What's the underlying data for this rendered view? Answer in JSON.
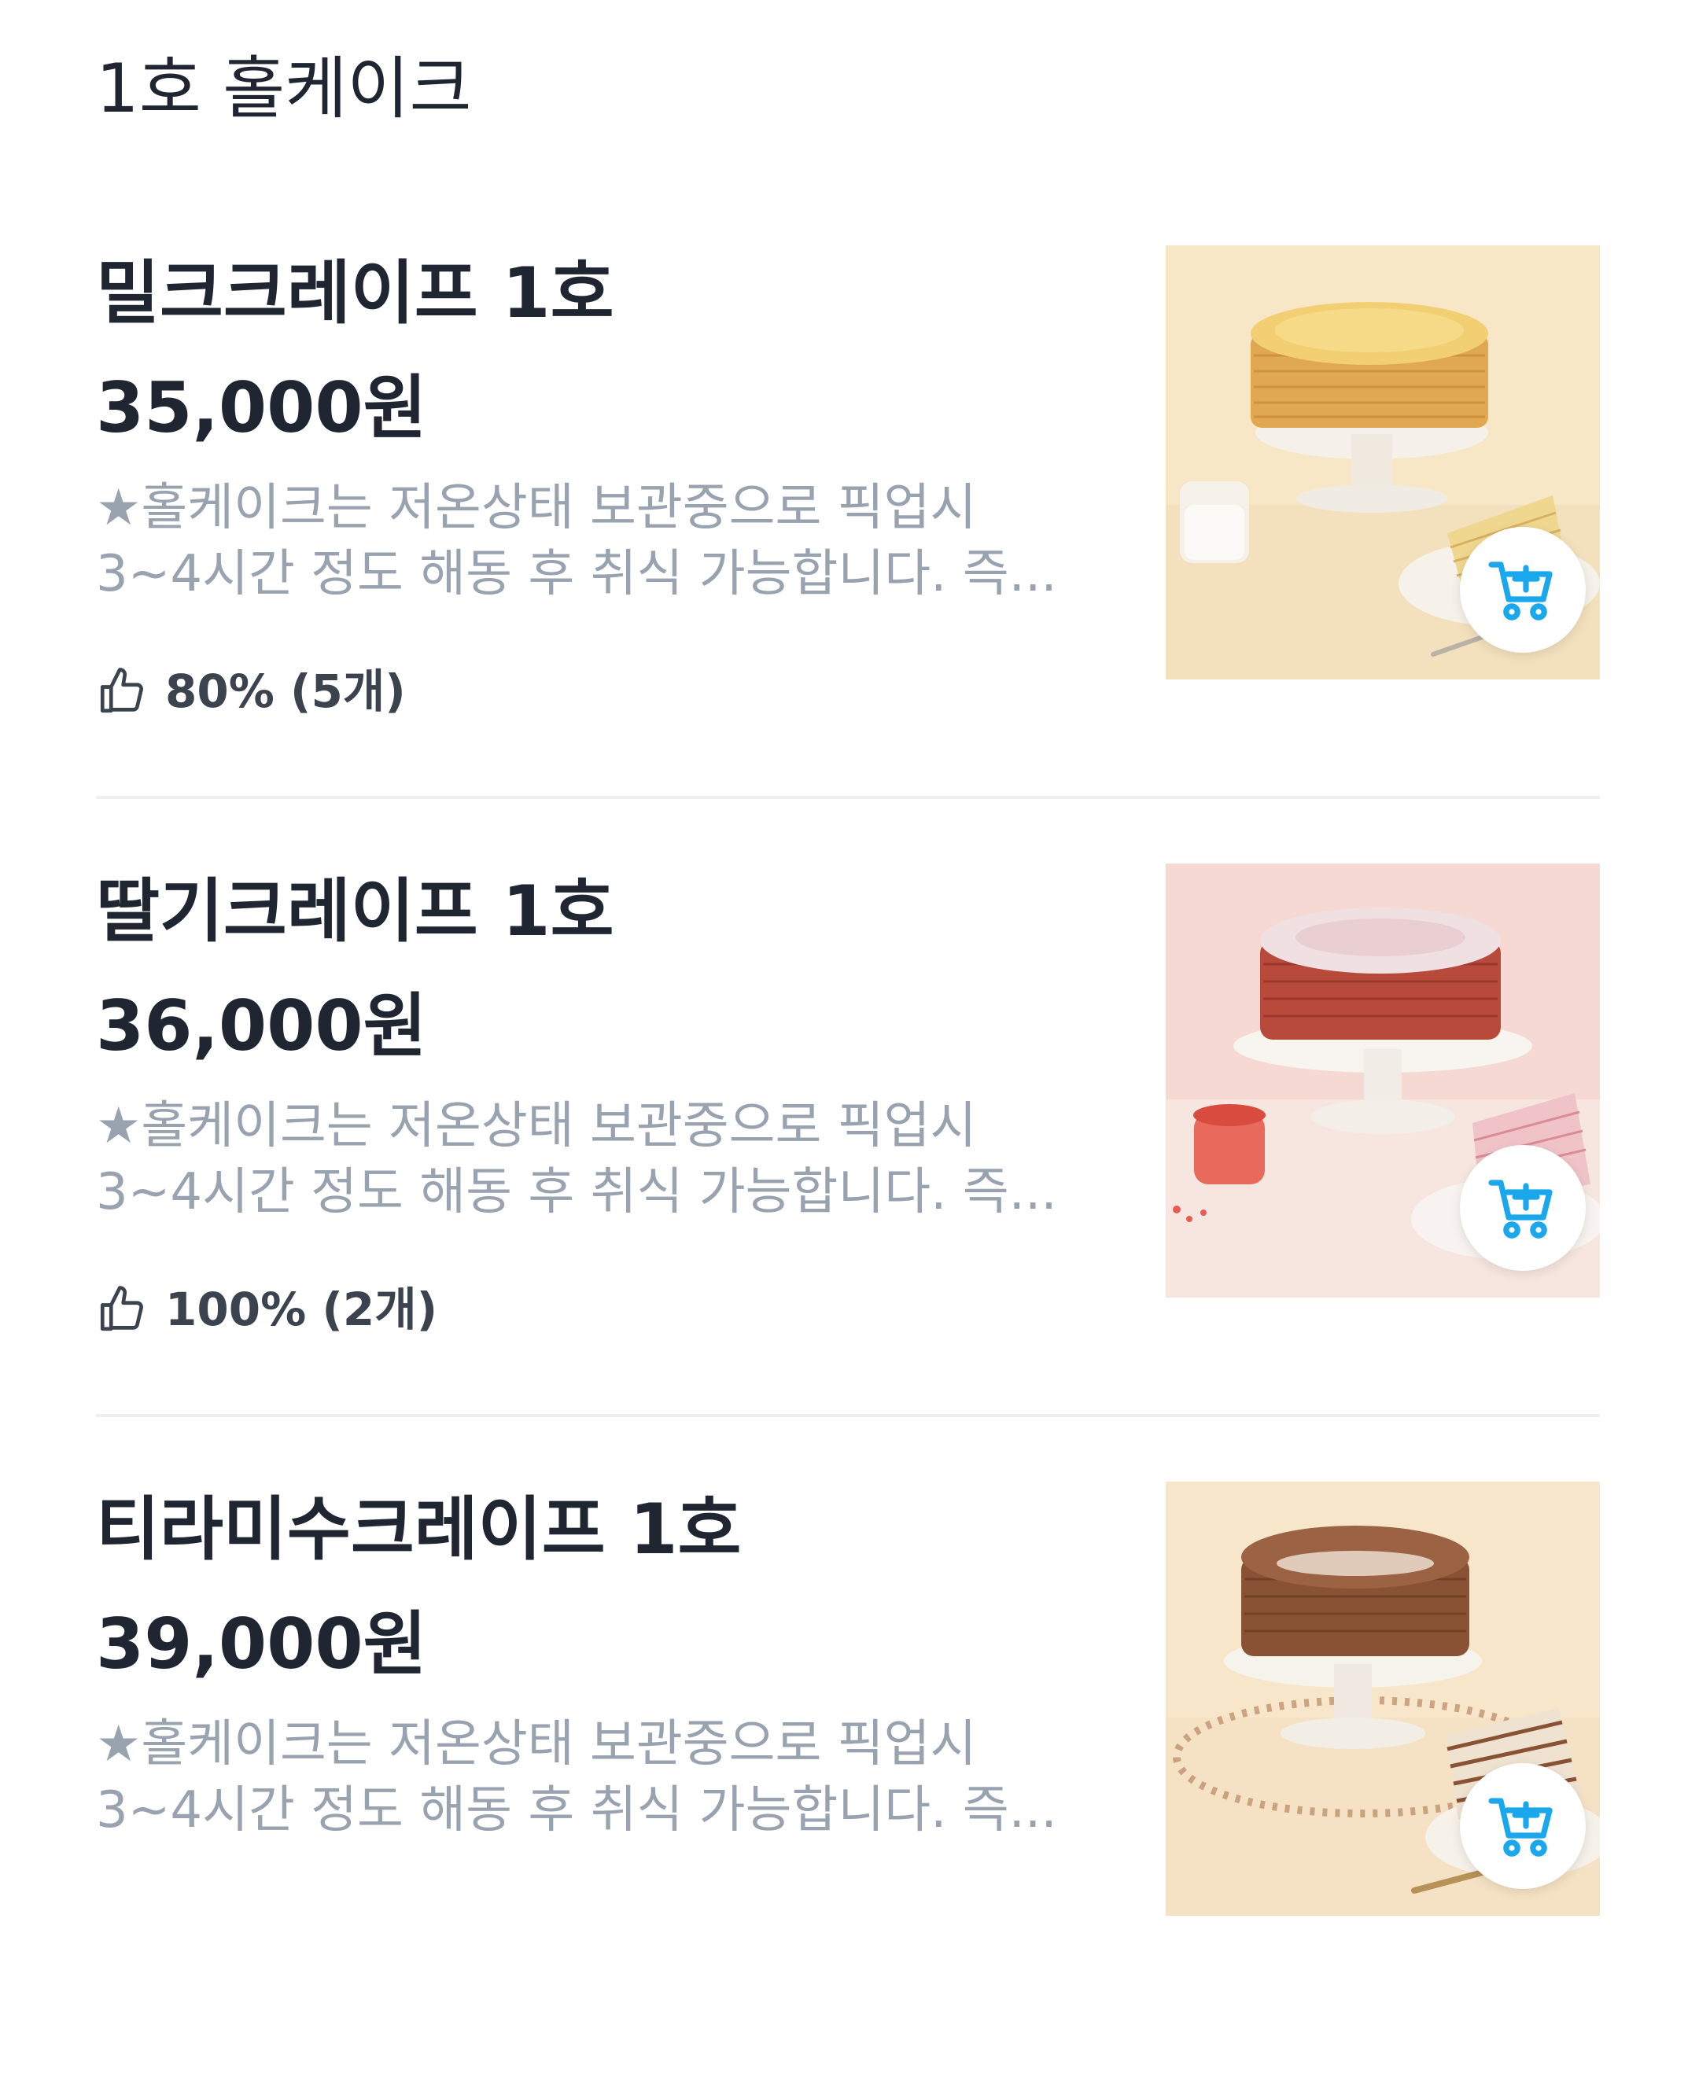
{
  "section": {
    "title": "1호 홀케이크"
  },
  "colors": {
    "text_primary": "#1f2631",
    "text_secondary": "#98a3af",
    "cart_accent": "#1aa7ec",
    "divider": "#eef0f2"
  },
  "items": [
    {
      "name": "밀크크레이프 1호",
      "price": "35,000원",
      "description_line1": "★홀케이크는 저온상태 보관중으로 픽업시",
      "description_line2": "3~4시간 정도 해동 후 취식 가능합니다. 즉...",
      "rating_icon": "thumbs-up-icon",
      "rating": "80% (5개)",
      "photo_subject": "milk crepe cake",
      "cart_icon": "cart-plus-icon"
    },
    {
      "name": "딸기크레이프 1호",
      "price": "36,000원",
      "description_line1": "★홀케이크는 저온상태 보관중으로 픽업시",
      "description_line2": "3~4시간 정도 해동 후 취식 가능합니다. 즉...",
      "rating_icon": "thumbs-up-icon",
      "rating": "100% (2개)",
      "photo_subject": "strawberry crepe cake",
      "cart_icon": "cart-plus-icon"
    },
    {
      "name": "티라미수크레이프 1호",
      "price": "39,000원",
      "description_line1": "★홀케이크는 저온상태 보관중으로 픽업시",
      "description_line2": "3~4시간 정도 해동 후 취식 가능합니다. 즉...",
      "photo_subject": "tiramisu crepe cake",
      "cart_icon": "cart-plus-icon"
    }
  ]
}
